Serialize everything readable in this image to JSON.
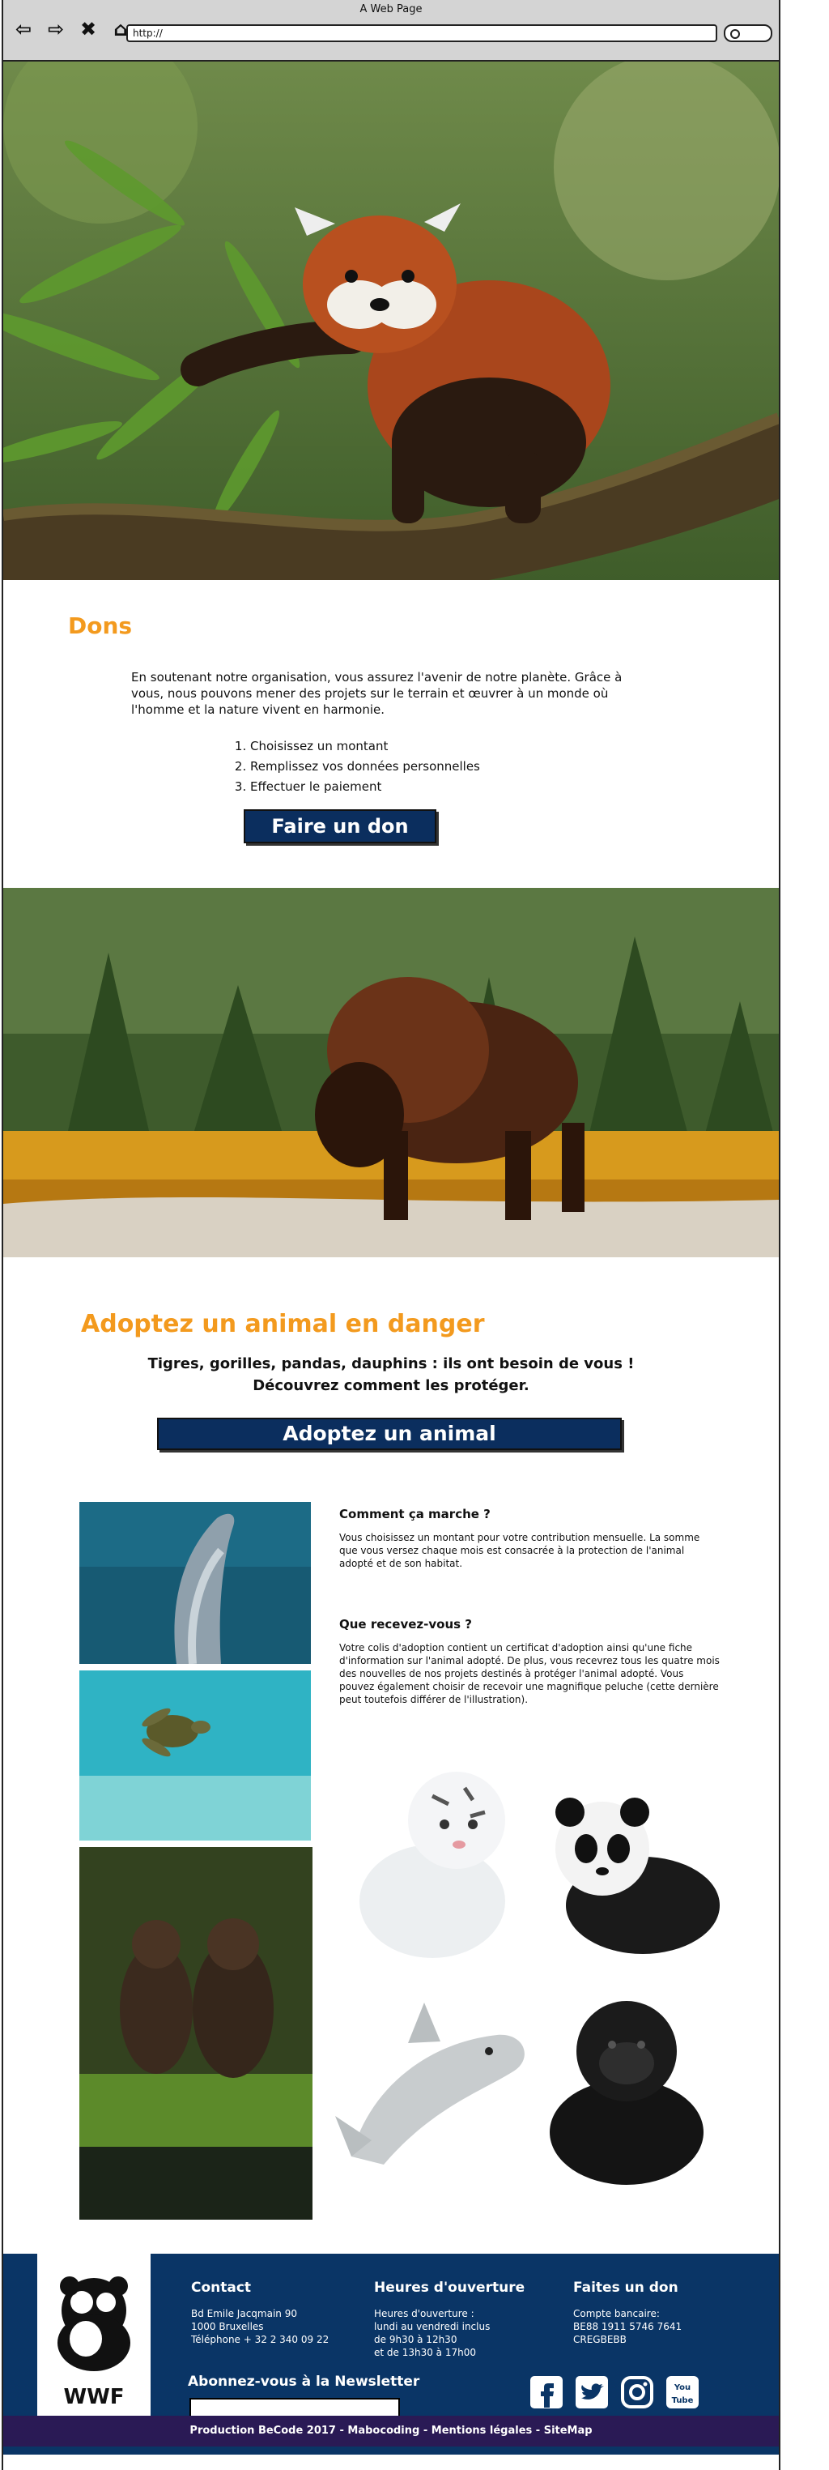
{
  "browser": {
    "window_title": "A Web Page",
    "url": "http://"
  },
  "hero1": {
    "image": "red-panda-on-branch"
  },
  "dons": {
    "title": "Dons",
    "intro": "En soutenant notre organisation, vous assurez l'avenir de notre planète. Grâce à vous, nous pouvons mener des projets sur le terrain et œuvrer à un monde où l'homme et la nature vivent en harmonie.",
    "steps": [
      "Choisissez un montant",
      "Remplissez vos données personnelles",
      "Effectuer le paiement"
    ],
    "button": "Faire un don"
  },
  "hero2": {
    "image": "bison-in-forest"
  },
  "adopt": {
    "title": "Adoptez un animal en danger",
    "tagline_1": "Tigres, gorilles, pandas, dauphins : ils ont besoin de vous !",
    "tagline_2": "Découvrez comment les protéger.",
    "button": "Adoptez un animal",
    "q1_title": "Comment ça marche ?",
    "q1_text": "Vous choisissez un montant pour votre contribution mensuelle. La somme que vous versez chaque mois est consacrée à la protection de l'animal adopté et de son habitat.",
    "q2_title": "Que recevez-vous ?",
    "q2_text": "Votre colis d'adoption contient un certificat d'adoption ainsi qu'une fiche d'information sur l'animal adopté. De plus, vous recevrez tous les quatre mois des nouvelles de nos projets destinés à protéger l'animal adopté. Vous pouvez également choisir de recevoir une magnifique peluche (cette dernière peut toutefois différer de l'illustration).",
    "photos": [
      "dolphin-photo",
      "sea-turtle-photo",
      "chimpanzees-photo"
    ],
    "plushies": [
      "tiger-plush",
      "panda-plush",
      "dolphin-plush",
      "gorilla-plush"
    ]
  },
  "footer": {
    "logo_text": "WWF",
    "contact_title": "Contact",
    "contact_text": "Bd Emile Jacqmain 90\n1000 Bruxelles\nTéléphone + 32 2 340 09 22",
    "hours_title": "Heures d'ouverture",
    "hours_text": "Heures d'ouverture :\nlundi au vendredi inclus\nde 9h30 à 12h30\net de 13h30 à 17h00",
    "don_title": "Faites un don",
    "don_text": "Compte bancaire:\nBE88 1911 5746 7641\nCREGBEBB",
    "newsletter_label": "Abonnez-vous à la Newsletter",
    "social": [
      "facebook-icon",
      "twitter-icon",
      "instagram-icon",
      "youtube-icon"
    ],
    "youtube_label": "You Tube",
    "bottom": "Production BeCode 2017 - Mabocoding - Mentions légales - SiteMap"
  },
  "colors": {
    "accent_orange": "#f39a1e",
    "navy": "#0a3566",
    "button_navy": "#0b2e5e",
    "bottom_bar": "#2a1a55"
  }
}
